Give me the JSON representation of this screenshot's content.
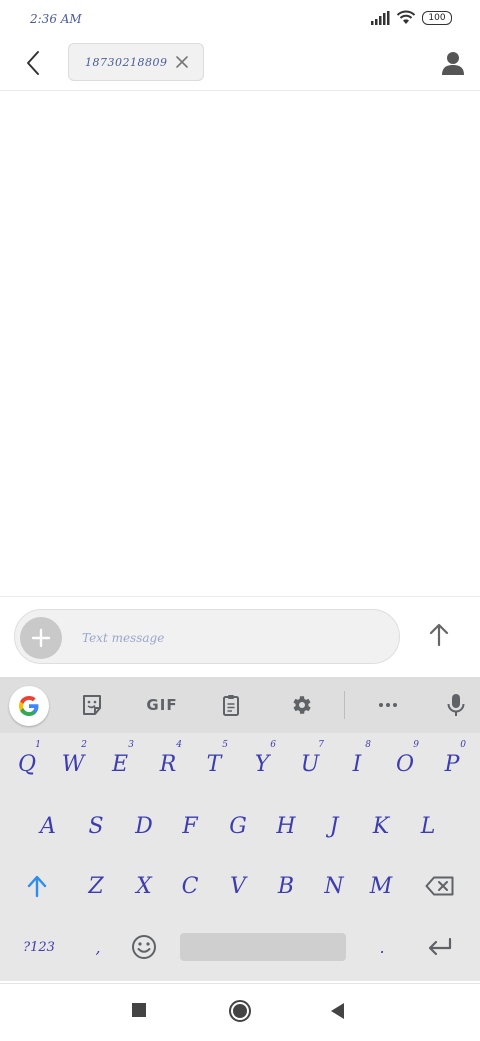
{
  "status_bar": {
    "time": "2:36 AM",
    "battery": "100",
    "icons": [
      "signal-icon",
      "wifi-icon",
      "battery-icon"
    ]
  },
  "header": {
    "recipient": "18730218809",
    "icons": [
      "back-arrow-icon",
      "close-icon",
      "contact-icon"
    ]
  },
  "compose": {
    "placeholder": "Text message",
    "icons": [
      "plus-icon",
      "send-arrow-icon"
    ]
  },
  "keyboard": {
    "toolbar": {
      "gif_label": "GIF",
      "icons": [
        "google-g-icon",
        "sticker-icon",
        "clipboard-icon",
        "gear-icon",
        "more-dots-icon",
        "mic-icon"
      ]
    },
    "row1": [
      {
        "key": "Q",
        "hint": "1"
      },
      {
        "key": "W",
        "hint": "2"
      },
      {
        "key": "E",
        "hint": "3"
      },
      {
        "key": "R",
        "hint": "4"
      },
      {
        "key": "T",
        "hint": "5"
      },
      {
        "key": "Y",
        "hint": "6"
      },
      {
        "key": "U",
        "hint": "7"
      },
      {
        "key": "I",
        "hint": "8"
      },
      {
        "key": "O",
        "hint": "9"
      },
      {
        "key": "P",
        "hint": "0"
      }
    ],
    "row2": [
      "A",
      "S",
      "D",
      "F",
      "G",
      "H",
      "J",
      "K",
      "L"
    ],
    "row3": [
      "Z",
      "X",
      "C",
      "V",
      "B",
      "N",
      "M"
    ],
    "symbols_label": "?123",
    "comma": ",",
    "period": ".",
    "colors": {
      "accent": "#2d8cf0",
      "key_text": "#3d3db0",
      "background": "#e7e7e7"
    }
  },
  "nav_bar": {
    "icons": [
      "recents-square-icon",
      "home-circle-icon",
      "back-triangle-icon"
    ]
  }
}
